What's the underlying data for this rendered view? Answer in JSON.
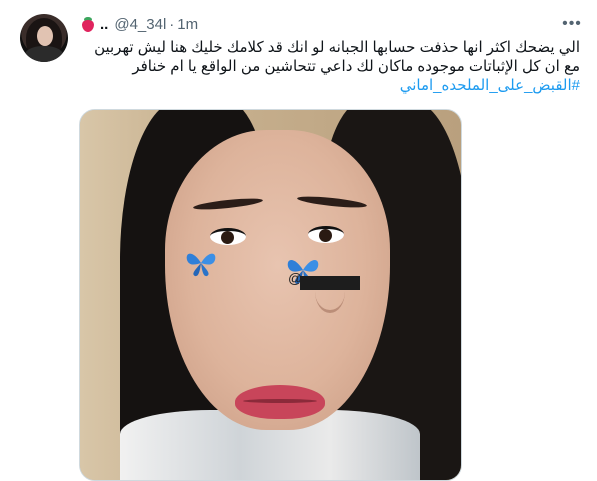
{
  "tweet": {
    "display_name_dots": "..",
    "handle": "@4_34l",
    "separator": "·",
    "time": "1m",
    "more_label": "•••",
    "text_line1": "الي يضحك اكثر انها حذفت حسابها الجبانه لو انك قد كلامك خليك هنا ليش تهربين",
    "text_line2": "مع ان كل الإثباتات موجوده ماكان لك داعي تتحاشين من الواقع يا ام خنافر",
    "hashtag": "#القبض_على_الملحده_اماني",
    "image_watermark": "@"
  }
}
